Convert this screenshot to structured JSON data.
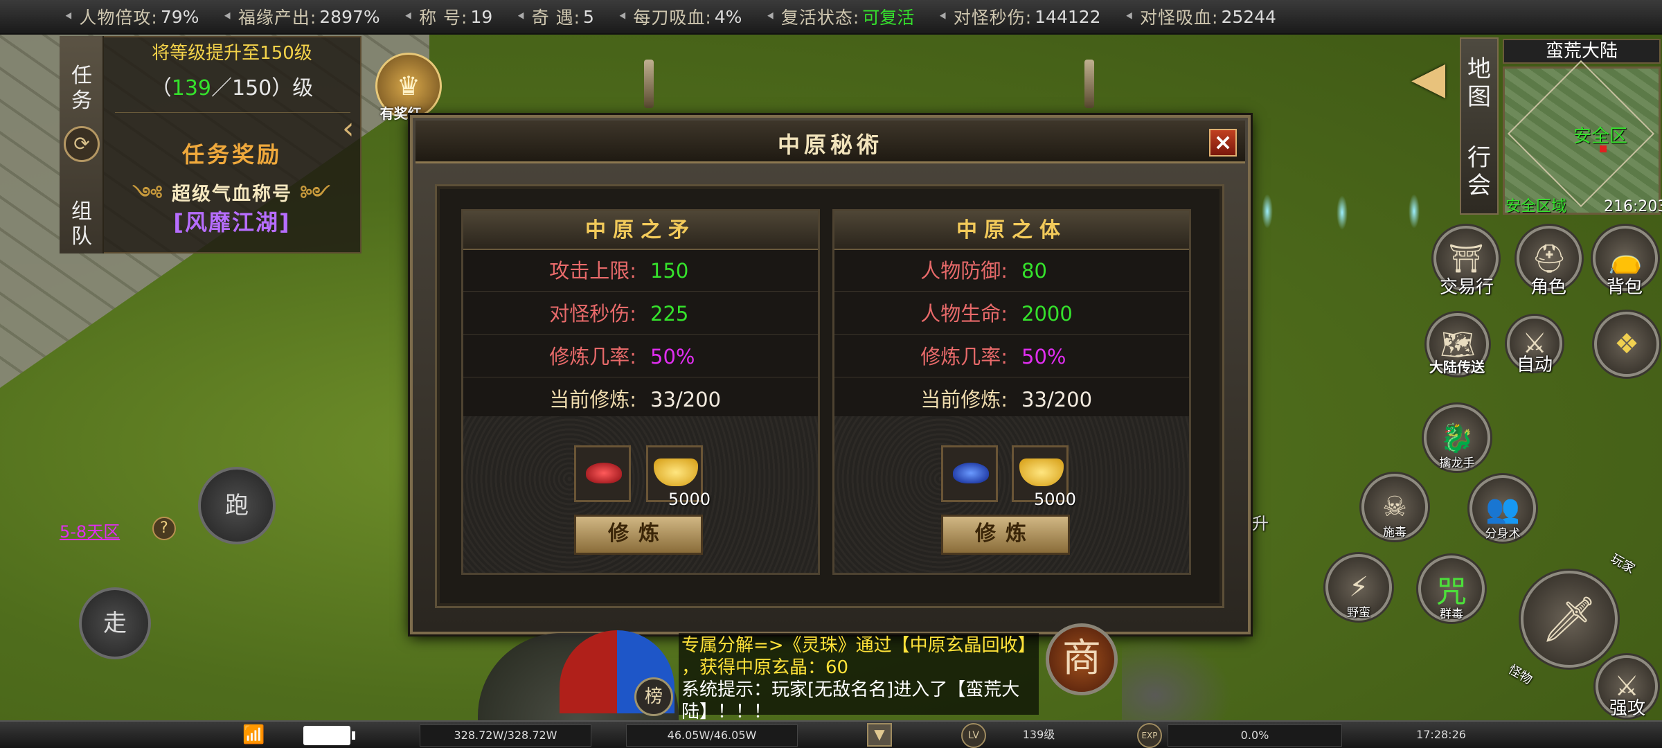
{
  "topbar": {
    "stats": [
      {
        "label": "人物倍攻:",
        "value": "79%"
      },
      {
        "label": "福缘产出:",
        "value": "2897%"
      },
      {
        "label": "称  号:",
        "value": "19"
      },
      {
        "label": "奇  遇:",
        "value": "5"
      },
      {
        "label": "每刀吸血:",
        "value": "4%"
      },
      {
        "label": "复活状态:",
        "value": "可复活"
      },
      {
        "label": "对怪秒伤:",
        "value": "144122"
      },
      {
        "label": "对怪吸血:",
        "value": "25244"
      }
    ]
  },
  "quest": {
    "tab_task": "任\n务",
    "tab_team": "组\n队",
    "title": "将等级提升至150级",
    "progress_open": "（",
    "progress_current": "139",
    "progress_sep": "／150）级",
    "reward_heading": "任务奖励",
    "reward_item": "超级气血称号",
    "reward_name": "[风靡江湖]"
  },
  "badge": {
    "label": "有奖红..."
  },
  "dialog": {
    "title": "中原秘術",
    "close": "×",
    "columns": [
      {
        "heading": "中原之矛",
        "rows": [
          {
            "key": "攻击上限:",
            "value": "150"
          },
          {
            "key": "对怪秒伤:",
            "value": "225"
          },
          {
            "key": "修炼几率:",
            "value": "50%"
          },
          {
            "key": "当前修炼:",
            "value": "33/200"
          }
        ],
        "gem_color": "#d0202a",
        "gold_qty": "5000",
        "button": "修炼"
      },
      {
        "heading": "中原之体",
        "rows": [
          {
            "key": "人物防御:",
            "value": "80"
          },
          {
            "key": "人物生命:",
            "value": "2000"
          },
          {
            "key": "修炼几率:",
            "value": "50%"
          },
          {
            "key": "当前修炼:",
            "value": "33/200"
          }
        ],
        "gem_color": "#2050d0",
        "gold_qty": "5000",
        "button": "修炼"
      }
    ]
  },
  "map": {
    "tab_map": "地\n图",
    "tab_guild": "行\n会",
    "name": "蛮荒大陆",
    "zone": "安全区",
    "area": "安全区域",
    "coords": "216:203"
  },
  "actions": {
    "trade": "交易行",
    "role": "角色",
    "bag": "背包",
    "teleport": "大陆传送",
    "auto": "自动",
    "skill_dragon": "擒龙手",
    "skill_poison": "施毒",
    "skill_clone": "分身术",
    "skill_wild": "野蛮",
    "skill_curse_glyph": "咒",
    "skill_groupcurse": "群毒",
    "skill_up": "升",
    "strong_attack": "强攻",
    "play": "玩家",
    "monster": "怪物"
  },
  "controls": {
    "run": "跑",
    "walk": "走",
    "day_zone": "5-8天区",
    "help": "?"
  },
  "chat": {
    "line1": "专属分解=>《灵珠》通过【中原玄晶回收】",
    "line2": "，获得中原玄晶：60",
    "line3": "系统提示：玩家[无敌名名]进入了【蛮荒大",
    "line4": "陆】！！！"
  },
  "rank_button": "榜",
  "shop_button": "商",
  "bottombar": {
    "hp": "328.72W/328.72W",
    "mp": "46.05W/46.05W",
    "lv_badge": "LV",
    "level": "139级",
    "exp_badge": "EXP",
    "exp": "0.0%",
    "time": "17:28:26"
  },
  "colors": {
    "green": "#35e22c",
    "magenta": "#e02ef0",
    "gold": "#f2ca5a"
  }
}
